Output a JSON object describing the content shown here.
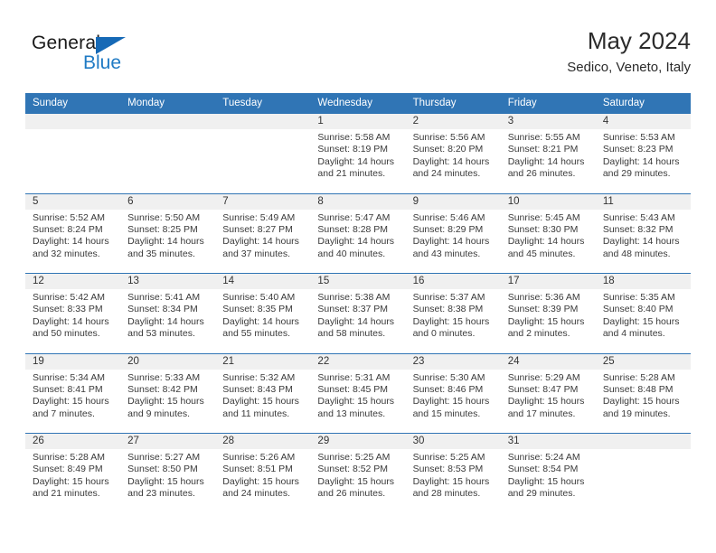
{
  "logo": {
    "word_one": "General",
    "word_two": "Blue"
  },
  "header": {
    "title": "May 2024",
    "subtitle": "Sedico, Veneto, Italy"
  },
  "colors": {
    "header_blue": "#3075b5",
    "logo_blue": "#1f7ac4",
    "daynum_band": "#f0f0f0",
    "text": "#3a3a3a"
  },
  "weekdays": [
    "Sunday",
    "Monday",
    "Tuesday",
    "Wednesday",
    "Thursday",
    "Friday",
    "Saturday"
  ],
  "weeks": [
    [
      {
        "day": "",
        "sunrise": "",
        "sunset": "",
        "daylight_1": "",
        "daylight_2": ""
      },
      {
        "day": "",
        "sunrise": "",
        "sunset": "",
        "daylight_1": "",
        "daylight_2": ""
      },
      {
        "day": "",
        "sunrise": "",
        "sunset": "",
        "daylight_1": "",
        "daylight_2": ""
      },
      {
        "day": "1",
        "sunrise": "Sunrise: 5:58 AM",
        "sunset": "Sunset: 8:19 PM",
        "daylight_1": "Daylight: 14 hours",
        "daylight_2": "and 21 minutes."
      },
      {
        "day": "2",
        "sunrise": "Sunrise: 5:56 AM",
        "sunset": "Sunset: 8:20 PM",
        "daylight_1": "Daylight: 14 hours",
        "daylight_2": "and 24 minutes."
      },
      {
        "day": "3",
        "sunrise": "Sunrise: 5:55 AM",
        "sunset": "Sunset: 8:21 PM",
        "daylight_1": "Daylight: 14 hours",
        "daylight_2": "and 26 minutes."
      },
      {
        "day": "4",
        "sunrise": "Sunrise: 5:53 AM",
        "sunset": "Sunset: 8:23 PM",
        "daylight_1": "Daylight: 14 hours",
        "daylight_2": "and 29 minutes."
      }
    ],
    [
      {
        "day": "5",
        "sunrise": "Sunrise: 5:52 AM",
        "sunset": "Sunset: 8:24 PM",
        "daylight_1": "Daylight: 14 hours",
        "daylight_2": "and 32 minutes."
      },
      {
        "day": "6",
        "sunrise": "Sunrise: 5:50 AM",
        "sunset": "Sunset: 8:25 PM",
        "daylight_1": "Daylight: 14 hours",
        "daylight_2": "and 35 minutes."
      },
      {
        "day": "7",
        "sunrise": "Sunrise: 5:49 AM",
        "sunset": "Sunset: 8:27 PM",
        "daylight_1": "Daylight: 14 hours",
        "daylight_2": "and 37 minutes."
      },
      {
        "day": "8",
        "sunrise": "Sunrise: 5:47 AM",
        "sunset": "Sunset: 8:28 PM",
        "daylight_1": "Daylight: 14 hours",
        "daylight_2": "and 40 minutes."
      },
      {
        "day": "9",
        "sunrise": "Sunrise: 5:46 AM",
        "sunset": "Sunset: 8:29 PM",
        "daylight_1": "Daylight: 14 hours",
        "daylight_2": "and 43 minutes."
      },
      {
        "day": "10",
        "sunrise": "Sunrise: 5:45 AM",
        "sunset": "Sunset: 8:30 PM",
        "daylight_1": "Daylight: 14 hours",
        "daylight_2": "and 45 minutes."
      },
      {
        "day": "11",
        "sunrise": "Sunrise: 5:43 AM",
        "sunset": "Sunset: 8:32 PM",
        "daylight_1": "Daylight: 14 hours",
        "daylight_2": "and 48 minutes."
      }
    ],
    [
      {
        "day": "12",
        "sunrise": "Sunrise: 5:42 AM",
        "sunset": "Sunset: 8:33 PM",
        "daylight_1": "Daylight: 14 hours",
        "daylight_2": "and 50 minutes."
      },
      {
        "day": "13",
        "sunrise": "Sunrise: 5:41 AM",
        "sunset": "Sunset: 8:34 PM",
        "daylight_1": "Daylight: 14 hours",
        "daylight_2": "and 53 minutes."
      },
      {
        "day": "14",
        "sunrise": "Sunrise: 5:40 AM",
        "sunset": "Sunset: 8:35 PM",
        "daylight_1": "Daylight: 14 hours",
        "daylight_2": "and 55 minutes."
      },
      {
        "day": "15",
        "sunrise": "Sunrise: 5:38 AM",
        "sunset": "Sunset: 8:37 PM",
        "daylight_1": "Daylight: 14 hours",
        "daylight_2": "and 58 minutes."
      },
      {
        "day": "16",
        "sunrise": "Sunrise: 5:37 AM",
        "sunset": "Sunset: 8:38 PM",
        "daylight_1": "Daylight: 15 hours",
        "daylight_2": "and 0 minutes."
      },
      {
        "day": "17",
        "sunrise": "Sunrise: 5:36 AM",
        "sunset": "Sunset: 8:39 PM",
        "daylight_1": "Daylight: 15 hours",
        "daylight_2": "and 2 minutes."
      },
      {
        "day": "18",
        "sunrise": "Sunrise: 5:35 AM",
        "sunset": "Sunset: 8:40 PM",
        "daylight_1": "Daylight: 15 hours",
        "daylight_2": "and 4 minutes."
      }
    ],
    [
      {
        "day": "19",
        "sunrise": "Sunrise: 5:34 AM",
        "sunset": "Sunset: 8:41 PM",
        "daylight_1": "Daylight: 15 hours",
        "daylight_2": "and 7 minutes."
      },
      {
        "day": "20",
        "sunrise": "Sunrise: 5:33 AM",
        "sunset": "Sunset: 8:42 PM",
        "daylight_1": "Daylight: 15 hours",
        "daylight_2": "and 9 minutes."
      },
      {
        "day": "21",
        "sunrise": "Sunrise: 5:32 AM",
        "sunset": "Sunset: 8:43 PM",
        "daylight_1": "Daylight: 15 hours",
        "daylight_2": "and 11 minutes."
      },
      {
        "day": "22",
        "sunrise": "Sunrise: 5:31 AM",
        "sunset": "Sunset: 8:45 PM",
        "daylight_1": "Daylight: 15 hours",
        "daylight_2": "and 13 minutes."
      },
      {
        "day": "23",
        "sunrise": "Sunrise: 5:30 AM",
        "sunset": "Sunset: 8:46 PM",
        "daylight_1": "Daylight: 15 hours",
        "daylight_2": "and 15 minutes."
      },
      {
        "day": "24",
        "sunrise": "Sunrise: 5:29 AM",
        "sunset": "Sunset: 8:47 PM",
        "daylight_1": "Daylight: 15 hours",
        "daylight_2": "and 17 minutes."
      },
      {
        "day": "25",
        "sunrise": "Sunrise: 5:28 AM",
        "sunset": "Sunset: 8:48 PM",
        "daylight_1": "Daylight: 15 hours",
        "daylight_2": "and 19 minutes."
      }
    ],
    [
      {
        "day": "26",
        "sunrise": "Sunrise: 5:28 AM",
        "sunset": "Sunset: 8:49 PM",
        "daylight_1": "Daylight: 15 hours",
        "daylight_2": "and 21 minutes."
      },
      {
        "day": "27",
        "sunrise": "Sunrise: 5:27 AM",
        "sunset": "Sunset: 8:50 PM",
        "daylight_1": "Daylight: 15 hours",
        "daylight_2": "and 23 minutes."
      },
      {
        "day": "28",
        "sunrise": "Sunrise: 5:26 AM",
        "sunset": "Sunset: 8:51 PM",
        "daylight_1": "Daylight: 15 hours",
        "daylight_2": "and 24 minutes."
      },
      {
        "day": "29",
        "sunrise": "Sunrise: 5:25 AM",
        "sunset": "Sunset: 8:52 PM",
        "daylight_1": "Daylight: 15 hours",
        "daylight_2": "and 26 minutes."
      },
      {
        "day": "30",
        "sunrise": "Sunrise: 5:25 AM",
        "sunset": "Sunset: 8:53 PM",
        "daylight_1": "Daylight: 15 hours",
        "daylight_2": "and 28 minutes."
      },
      {
        "day": "31",
        "sunrise": "Sunrise: 5:24 AM",
        "sunset": "Sunset: 8:54 PM",
        "daylight_1": "Daylight: 15 hours",
        "daylight_2": "and 29 minutes."
      },
      {
        "day": "",
        "sunrise": "",
        "sunset": "",
        "daylight_1": "",
        "daylight_2": ""
      }
    ]
  ]
}
